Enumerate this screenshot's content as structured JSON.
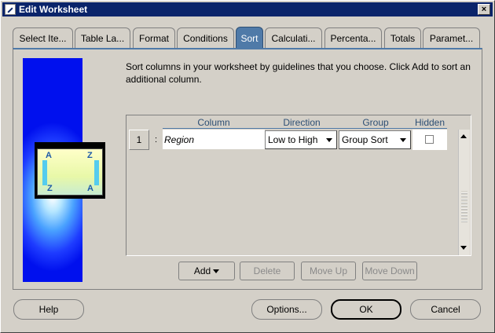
{
  "window": {
    "title": "Edit Worksheet",
    "close_label": "×"
  },
  "tabs": [
    {
      "label": "Select Ite...",
      "active": false
    },
    {
      "label": "Table La...",
      "active": false
    },
    {
      "label": "Format",
      "active": false
    },
    {
      "label": "Conditions",
      "active": false
    },
    {
      "label": "Sort",
      "active": true
    },
    {
      "label": "Calculati...",
      "active": false
    },
    {
      "label": "Percenta...",
      "active": false
    },
    {
      "label": "Totals",
      "active": false
    },
    {
      "label": "Paramet...",
      "active": false
    }
  ],
  "illustration": {
    "letters": [
      "A",
      "Z",
      "Z",
      "A"
    ]
  },
  "sort": {
    "description": "Sort columns in your worksheet by guidelines that you choose.  Click Add to sort an additional column.",
    "headers": {
      "column": "Column",
      "direction": "Direction",
      "group": "Group",
      "hidden": "Hidden"
    },
    "rows": [
      {
        "num": "1",
        "marker": ":",
        "column": "Region",
        "direction": "Low to High",
        "group": "Group Sort",
        "hidden": false
      }
    ],
    "buttons": {
      "add": "Add",
      "delete": "Delete",
      "move_up": "Move Up",
      "move_down": "Move Down"
    }
  },
  "footer": {
    "help": "Help",
    "options": "Options...",
    "ok": "OK",
    "cancel": "Cancel"
  }
}
